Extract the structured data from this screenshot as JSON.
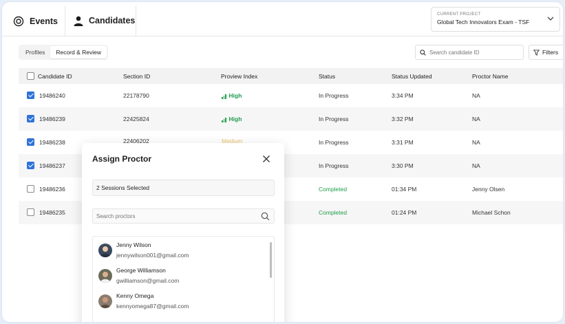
{
  "header": {
    "tabs": [
      {
        "label": "Events",
        "icon": "events-icon"
      },
      {
        "label": "Candidates",
        "icon": "person-icon"
      }
    ],
    "project": {
      "label": "CURRENT PROJECT",
      "value": "Global Tech Innovators Exam - TSF"
    }
  },
  "toolbar": {
    "segments": [
      "Profiles",
      "Record & Review"
    ],
    "active_segment": "Record & Review",
    "search_placeholder": "Search candidate ID",
    "filters_label": "Filters"
  },
  "table": {
    "columns": [
      "Candidate ID",
      "Section ID",
      "Proview Index",
      "Status",
      "Status Updated",
      "Proctor Name"
    ],
    "rows": [
      {
        "checked": true,
        "candidate_id": "19486240",
        "section_id": "22178790",
        "proview_index": "High",
        "status": "In Progress",
        "status_updated": "3:34 PM",
        "proctor": "NA"
      },
      {
        "checked": true,
        "candidate_id": "19486239",
        "section_id": "22425824",
        "proview_index": "High",
        "status": "In Progress",
        "status_updated": "3:32 PM",
        "proctor": "NA"
      },
      {
        "checked": true,
        "candidate_id": "19486238",
        "section_id": "22406202",
        "proview_index": "Medium",
        "status": "In Progress",
        "status_updated": "3:31 PM",
        "proctor": "NA"
      },
      {
        "checked": true,
        "candidate_id": "19486237",
        "section_id": "",
        "proview_index": "",
        "status": "In Progress",
        "status_updated": "3:30 PM",
        "proctor": "NA"
      },
      {
        "checked": false,
        "candidate_id": "19486236",
        "section_id": "",
        "proview_index": "",
        "status": "Completed",
        "status_updated": "01:34 PM",
        "proctor": "Jenny Olsen"
      },
      {
        "checked": false,
        "candidate_id": "19486235",
        "section_id": "",
        "proview_index": "",
        "status": "Completed",
        "status_updated": "01:24 PM",
        "proctor": "Michael Schon"
      }
    ]
  },
  "modal": {
    "title": "Assign Proctor",
    "selected_text": "2 Sessions Selected",
    "search_placeholder": "Search proctors",
    "proctors": [
      {
        "name": "Jenny Wilson",
        "email": "jennywilson001@gmail.com"
      },
      {
        "name": "George Williamson",
        "email": "gwilliamson@gmail.com"
      },
      {
        "name": "Kenny Omega",
        "email": "kennyomega87@gmail.com"
      }
    ]
  },
  "colors": {
    "accent": "#2f73d9",
    "success": "#1f9d4c",
    "text": "#1d1d1d"
  }
}
